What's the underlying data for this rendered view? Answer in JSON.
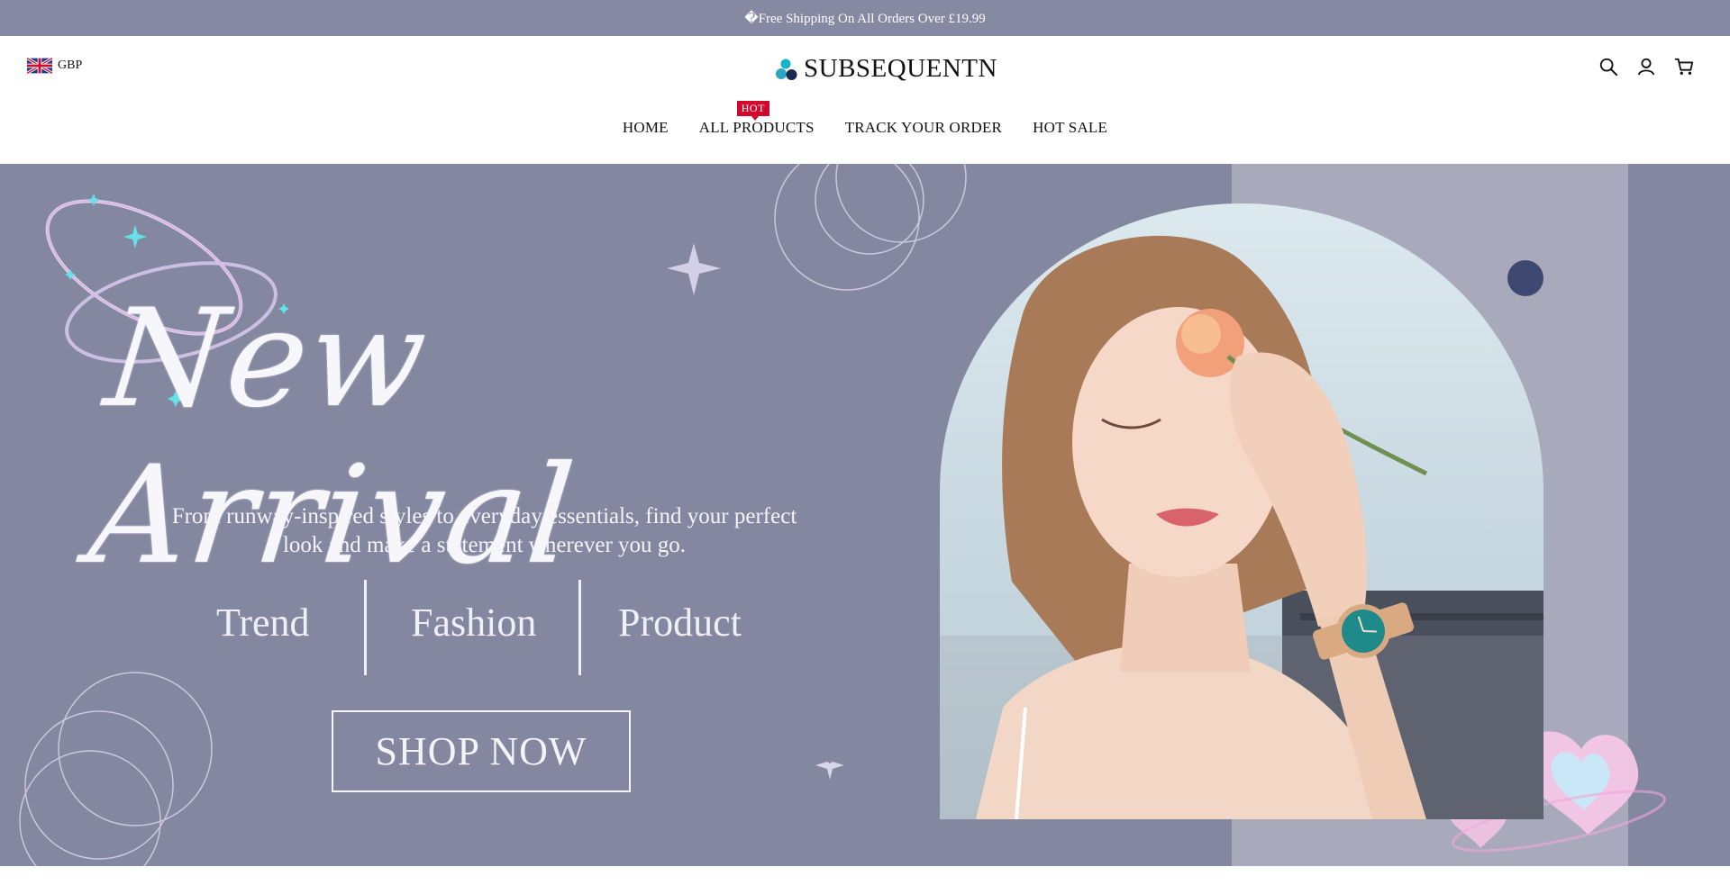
{
  "announcement": {
    "text": "�Free Shipping On All Orders Over £19.99"
  },
  "header": {
    "currency": {
      "code": "GBP",
      "flag_icon": "uk-flag-icon"
    },
    "logo_text": "SUBSEQUENTN",
    "icons": [
      "search-icon",
      "user-icon",
      "cart-icon"
    ]
  },
  "nav": {
    "items": [
      {
        "label": "HOME"
      },
      {
        "label": "ALL PRODUCTS",
        "badge": "HOT"
      },
      {
        "label": "TRACK YOUR ORDER"
      },
      {
        "label": "HOT SALE"
      }
    ]
  },
  "hero": {
    "headline": "New Arrival",
    "subtitle_line1": "From runway-inspired styles to everyday essentials, find your perfect",
    "subtitle_line2": "look and make a statement wherever you go.",
    "tags": [
      "Trend",
      "Fashion",
      "Product"
    ],
    "cta_label": "SHOP NOW"
  },
  "colors": {
    "announcement_bg": "#8589a2",
    "hero_bg": "#8387a0",
    "hot_badge": "#d10a2b",
    "accent_dot": "#3f4870"
  }
}
